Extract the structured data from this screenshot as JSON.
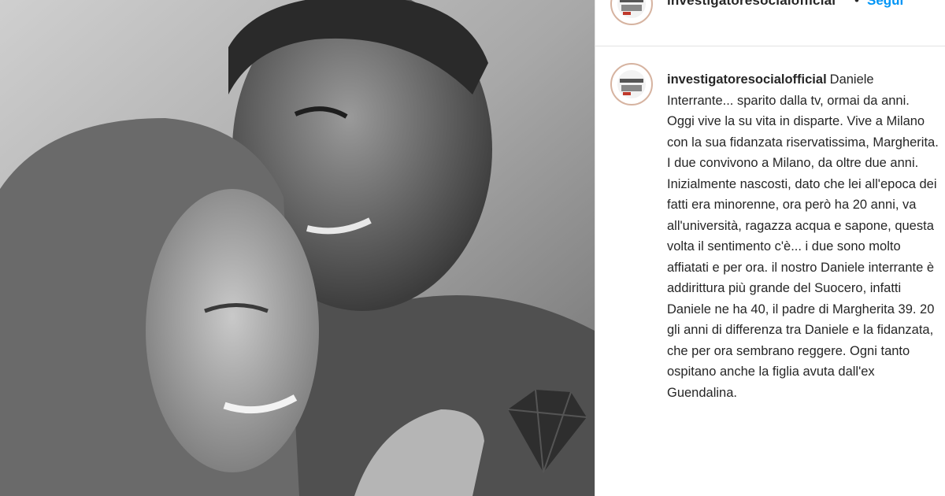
{
  "photo": {
    "alt_icon": "couple-photo"
  },
  "header": {
    "username": "investigatoresocialofficial",
    "separator": "•",
    "follow_label": "Segui",
    "avatar_icon": "profile-avatar-icon"
  },
  "post": {
    "username": "investigatoresocialofficial",
    "caption": "Daniele Interrante... sparito dalla tv, ormai da anni. Oggi vive la su vita in disparte. Vive a Milano con la sua fidanzata riservatissima, Margherita. I due convivono a Milano, da oltre due anni. Inizialmente nascosti, dato che lei all'epoca dei fatti era minorenne, ora però ha 20 anni, va all'università, ragazza acqua e sapone, questa volta il sentimento c'è... i due sono molto affiatati e per ora. il nostro Daniele interrante è addirittura più grande del Suocero, infatti Daniele ne ha 40, il padre di Margherita 39. 20 gli anni di differenza tra Daniele e la fidanzata, che per ora sembrano reggere. Ogni tanto ospitano anche la figlia avuta dall'ex Guendalina."
  },
  "colors": {
    "link": "#0095f6",
    "text": "#262626",
    "border": "#e3e3e3"
  }
}
